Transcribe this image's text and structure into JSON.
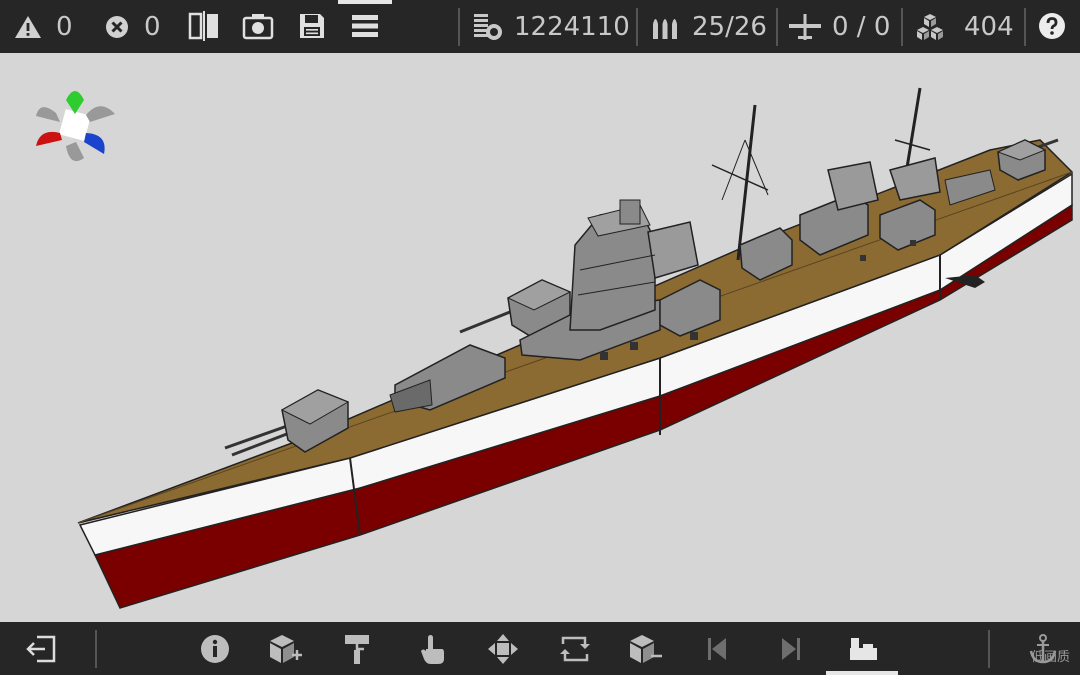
{
  "topbar": {
    "warnings_count": "0",
    "errors_count": "0",
    "cost": "1224110",
    "ammo": "25/26",
    "aircraft": "0 / 0",
    "blocks": "404"
  },
  "icons": {
    "warning": "warning-icon",
    "error": "error-icon",
    "mirror": "mirror-icon",
    "camera": "camera-icon",
    "save": "save-icon",
    "menu": "menu-icon",
    "cost": "cost-icon",
    "ammo": "ammo-icon",
    "aircraft": "aircraft-icon",
    "blocks": "blocks-icon",
    "help": "help-icon"
  },
  "bottombar": {
    "tools": [
      "exit",
      "info",
      "add-block",
      "paint",
      "touch",
      "move",
      "rotate",
      "remove-block",
      "prev",
      "next",
      "build"
    ]
  },
  "watermark": "低画质",
  "colors": {
    "bar": "#262626",
    "sky": "#d6d6d6",
    "deck": "#8c6b33",
    "hull_red": "#7a0000",
    "hull_white": "#f5f5f5",
    "superstructure": "#8a8a8a"
  }
}
